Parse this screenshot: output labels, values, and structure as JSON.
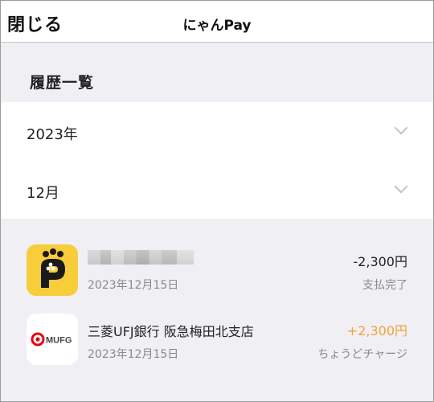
{
  "header": {
    "close_label": "閉じる",
    "title": "にゃんPay"
  },
  "section": {
    "title": "履歴一覧"
  },
  "filters": {
    "year": "2023年",
    "month": "12月"
  },
  "transactions": [
    {
      "name": "",
      "name_redacted": true,
      "date": "2023年12月15日",
      "amount": "-2,300円",
      "status": "支払完了",
      "icon": "cat-paw-app-icon"
    },
    {
      "name": "三菱UFJ銀行 阪急梅田北支店",
      "date": "2023年12月15日",
      "amount": "+2,300円",
      "status": "ちょうどチャージ",
      "icon": "mufg-logo-icon",
      "logo_text": "MUFG"
    }
  ],
  "colors": {
    "accent_plus": "#f2a23a",
    "cat_icon_bg": "#f7cd3a",
    "mufg_red": "#e60012"
  }
}
